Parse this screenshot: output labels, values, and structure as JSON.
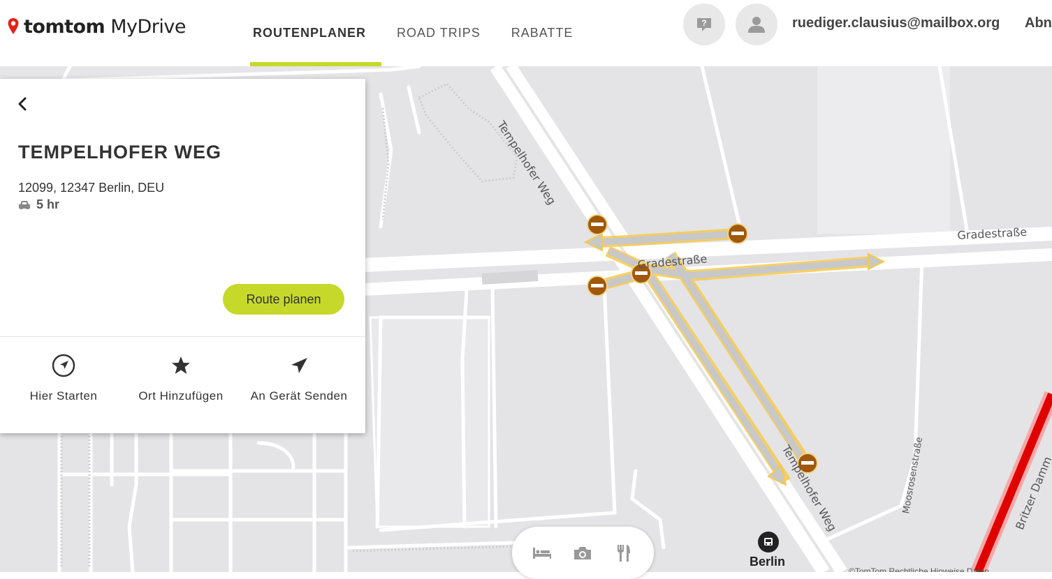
{
  "header": {
    "logo_brand": "tomtom",
    "logo_product": "MyDrive",
    "tabs": [
      {
        "label": "ROUTENPLANER",
        "active": true
      },
      {
        "label": "ROAD TRIPS",
        "active": false
      },
      {
        "label": "RABATTE",
        "active": false
      }
    ],
    "user_email": "ruediger.clausius@mailbox.org",
    "logout_label": "Abn"
  },
  "panel": {
    "title": "TEMPELHOFER WEG",
    "address": "12099, 12347 Berlin, DEU",
    "eta": "5 hr",
    "route_button": "Route planen",
    "actions": [
      {
        "label": "Hier Starten",
        "icon": "navigate-icon"
      },
      {
        "label": "Ort Hinzufügen",
        "icon": "star-icon"
      },
      {
        "label": "An Gerät Senden",
        "icon": "send-icon"
      }
    ]
  },
  "map": {
    "street_labels": {
      "tempelhofer_top": "Tempelhofer Weg",
      "tempelhofer_bottom": "Tempelhofer Weg",
      "gradestrasse_center": "Gradestraße",
      "gradestrasse_right": "Gradestraße",
      "moosrosenstrasse": "Moosrosenstraße",
      "britzer_damm": "Britzer Damm"
    },
    "poi_label": "Berlin",
    "copyright": "©TomTom Rechtliche Hinweise Daten",
    "colors": {
      "route_highlight": "#f7c948",
      "closure": "#a0580a",
      "traffic_jam": "#e00000",
      "accent": "#c6d92a"
    }
  },
  "poi_toolbar": [
    {
      "icon": "bed-icon"
    },
    {
      "icon": "camera-icon"
    },
    {
      "icon": "restaurant-icon"
    }
  ]
}
